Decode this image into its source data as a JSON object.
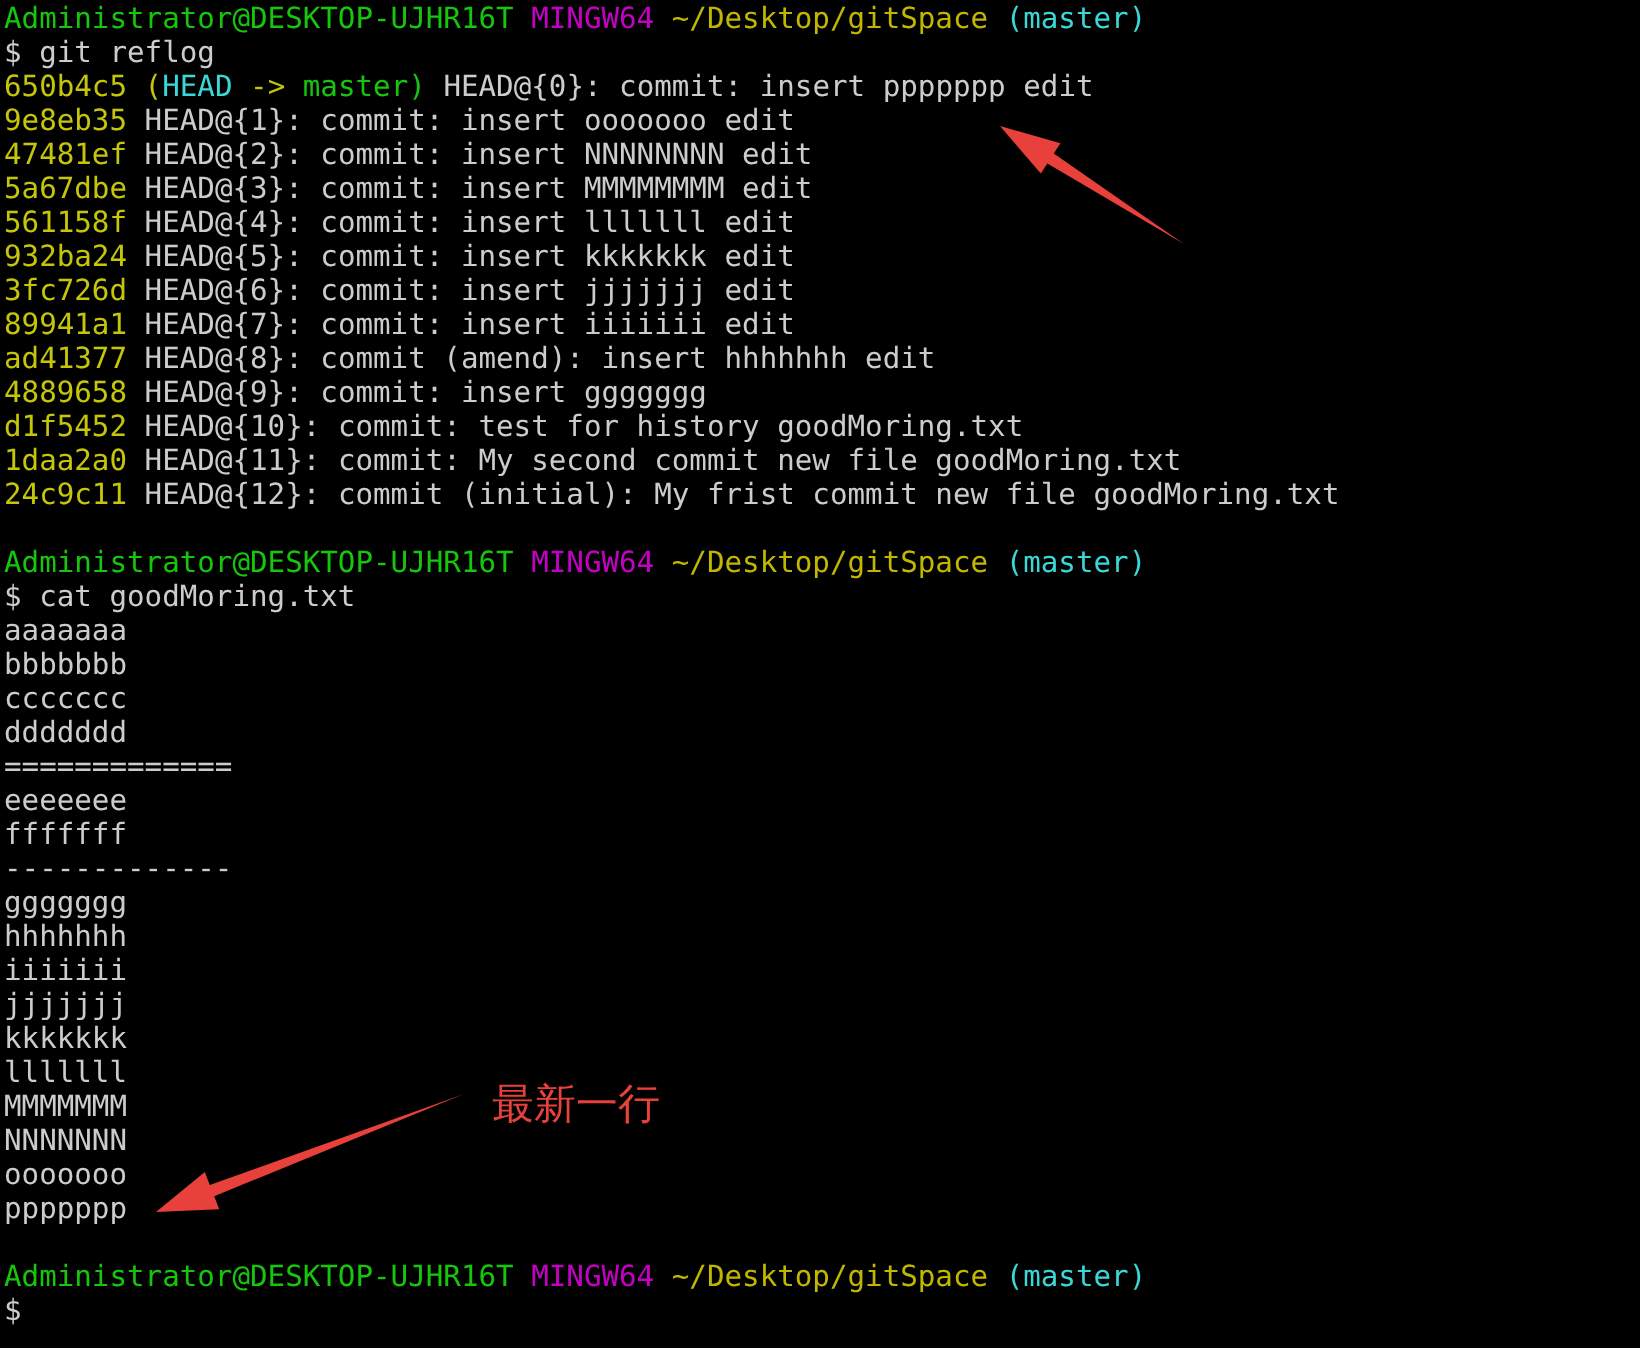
{
  "blocks": [
    {
      "prompt": {
        "user_host": "Administrator@DESKTOP-UJHR16T",
        "system": "MINGW64",
        "path": "~/Desktop/gitSpace",
        "branch": "(master)"
      },
      "command": "$ git reflog",
      "output": [
        {
          "kind": "reflog",
          "hash": "650b4c5",
          "decoration": [
            {
              "text": "(",
              "kind": "punct"
            },
            {
              "text": "HEAD",
              "kind": "head"
            },
            {
              "text": "->",
              "kind": "punct"
            },
            {
              "text": "master)",
              "kind": "branch"
            }
          ],
          "text": "HEAD@{0}: commit: insert ppppppp edit"
        },
        {
          "kind": "reflog",
          "hash": "9e8eb35",
          "text": "HEAD@{1}: commit: insert ooooooo edit"
        },
        {
          "kind": "reflog",
          "hash": "47481ef",
          "text": "HEAD@{2}: commit: insert NNNNNNNN edit"
        },
        {
          "kind": "reflog",
          "hash": "5a67dbe",
          "text": "HEAD@{3}: commit: insert MMMMMMMM edit"
        },
        {
          "kind": "reflog",
          "hash": "561158f",
          "text": "HEAD@{4}: commit: insert lllllll edit"
        },
        {
          "kind": "reflog",
          "hash": "932ba24",
          "text": "HEAD@{5}: commit: insert kkkkkkk edit"
        },
        {
          "kind": "reflog",
          "hash": "3fc726d",
          "text": "HEAD@{6}: commit: insert jjjjjjj edit"
        },
        {
          "kind": "reflog",
          "hash": "89941a1",
          "text": "HEAD@{7}: commit: insert iiiiiii edit"
        },
        {
          "kind": "reflog",
          "hash": "ad41377",
          "text": "HEAD@{8}: commit (amend): insert hhhhhhh edit"
        },
        {
          "kind": "reflog",
          "hash": "4889658",
          "text": "HEAD@{9}: commit: insert ggggggg"
        },
        {
          "kind": "reflog",
          "hash": "d1f5452",
          "text": "HEAD@{10}: commit: test for history goodMoring.txt"
        },
        {
          "kind": "reflog",
          "hash": "1daa2a0",
          "text": "HEAD@{11}: commit: My second commit new file goodMoring.txt"
        },
        {
          "kind": "reflog",
          "hash": "24c9c11",
          "text": "HEAD@{12}: commit (initial): My frist commit new file goodMoring.txt"
        }
      ]
    },
    {
      "prompt": {
        "user_host": "Administrator@DESKTOP-UJHR16T",
        "system": "MINGW64",
        "path": "~/Desktop/gitSpace",
        "branch": "(master)"
      },
      "command": "$ cat goodMoring.txt",
      "output": [
        {
          "kind": "plain",
          "text": "aaaaaaa"
        },
        {
          "kind": "plain",
          "text": "bbbbbbb"
        },
        {
          "kind": "plain",
          "text": "ccccccc"
        },
        {
          "kind": "plain",
          "text": "ddddddd"
        },
        {
          "kind": "plain",
          "text": "============="
        },
        {
          "kind": "plain",
          "text": "eeeeeee"
        },
        {
          "kind": "plain",
          "text": "fffffff"
        },
        {
          "kind": "plain",
          "text": "-------------"
        },
        {
          "kind": "plain",
          "text": "ggggggg"
        },
        {
          "kind": "plain",
          "text": "hhhhhhh"
        },
        {
          "kind": "plain",
          "text": "iiiiiii"
        },
        {
          "kind": "plain",
          "text": "jjjjjjj"
        },
        {
          "kind": "plain",
          "text": "kkkkkkk"
        },
        {
          "kind": "plain",
          "text": "lllllll"
        },
        {
          "kind": "plain",
          "text": "MMMMMMM"
        },
        {
          "kind": "plain",
          "text": "NNNNNNN"
        },
        {
          "kind": "plain",
          "text": "ooooooo"
        },
        {
          "kind": "plain",
          "text": "ppppppp"
        }
      ]
    },
    {
      "prompt": {
        "user_host": "Administrator@DESKTOP-UJHR16T",
        "system": "MINGW64",
        "path": "~/Desktop/gitSpace",
        "branch": "(master)"
      },
      "command": "$"
    }
  ],
  "annotation": {
    "label": "最新一行"
  }
}
